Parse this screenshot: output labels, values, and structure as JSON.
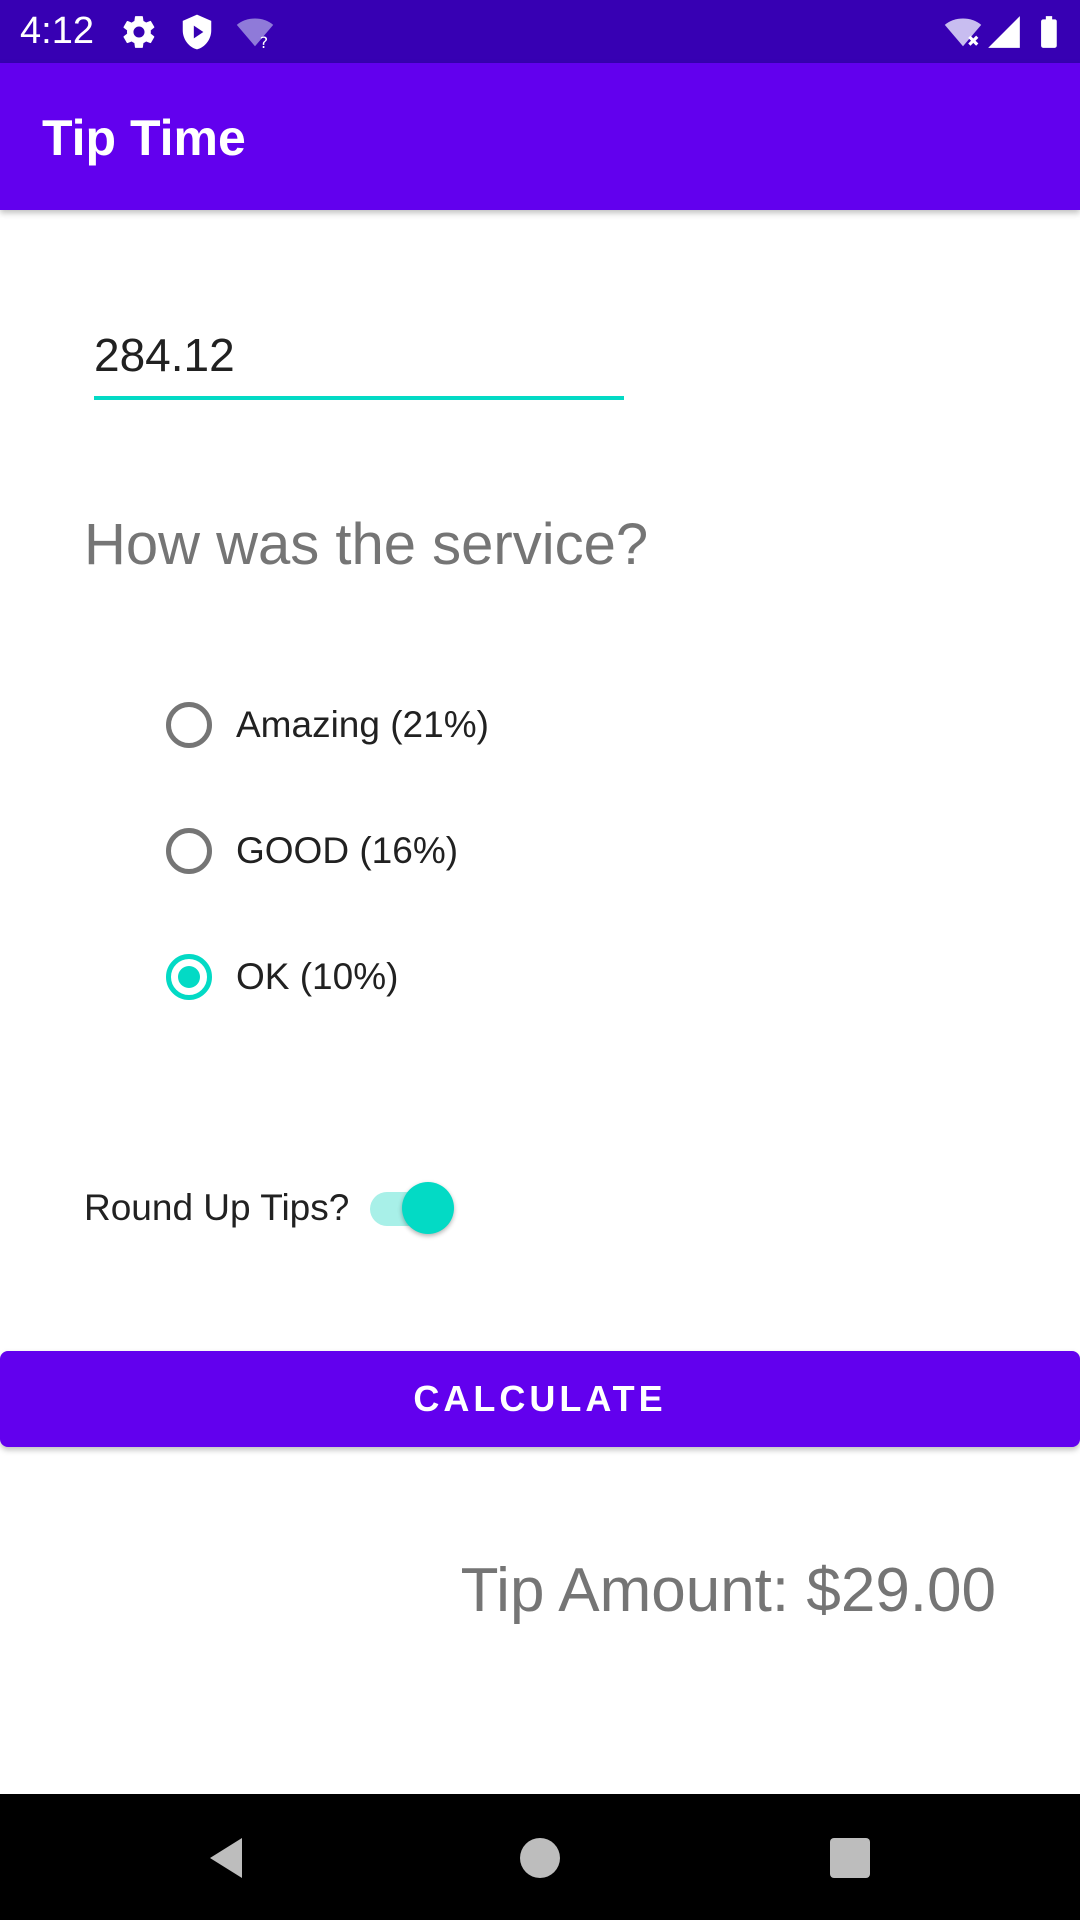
{
  "status_bar": {
    "time": "4:12",
    "icons": [
      "gear-icon",
      "shield-icon",
      "wifi-question-icon",
      "wifi-off-icon",
      "signal-icon",
      "battery-icon"
    ]
  },
  "app_bar": {
    "title": "Tip Time"
  },
  "cost_input": {
    "value": "284.12"
  },
  "service_question": "How was the service?",
  "tip_options": [
    {
      "label": "Amazing (21%)",
      "checked": false
    },
    {
      "label": "GOOD (16%)",
      "checked": false
    },
    {
      "label": "OK (10%)",
      "checked": true
    }
  ],
  "round_up": {
    "label": "Round Up Tips?",
    "on": true
  },
  "calculate_button": {
    "label": "CALCULATE"
  },
  "tip_result": "Tip Amount: $29.00",
  "colors": {
    "primary": "#6200ee",
    "primary_dark": "#3700b3",
    "accent": "#03dac5",
    "text_secondary": "#757575",
    "text_primary": "#212121"
  },
  "nav_bar": {
    "icons": [
      "back-icon",
      "home-icon",
      "recents-icon"
    ]
  }
}
